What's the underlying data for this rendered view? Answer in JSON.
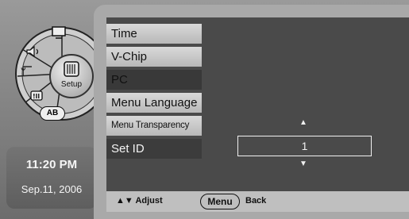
{
  "dial": {
    "center_label": "Setup",
    "badges": [
      "AB"
    ],
    "icons": [
      "picture-icon",
      "speaker-icon",
      "antenna-icon",
      "parental-control-icon",
      "setup-tools-icon"
    ]
  },
  "clock": {
    "time": "11:20 PM",
    "date": "Sep.11, 2006"
  },
  "menu": {
    "items": [
      "Time",
      "V-Chip",
      "PC",
      "Menu Language",
      "Menu Transparency",
      "Set ID"
    ],
    "selected": "Set ID"
  },
  "setid": {
    "value": "1"
  },
  "help": {
    "adjust": "Adjust",
    "menu": "Menu",
    "back": "Back"
  },
  "colors": {
    "screen": "#4a4a4a",
    "item": "#c8c8c8",
    "selected": "#3c3c3c",
    "text_light": "#f0f0f0"
  }
}
